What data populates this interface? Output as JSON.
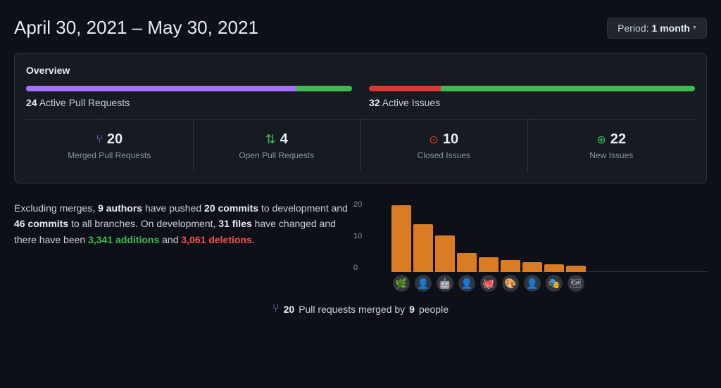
{
  "header": {
    "title": "April 30, 2021 – May 30, 2021",
    "period_label": "Period:",
    "period_value": "1 month"
  },
  "overview": {
    "title": "Overview",
    "pull_requests": {
      "label": "Active Pull Requests",
      "count": "24",
      "bar_purple_pct": 83,
      "bar_green_pct": 17
    },
    "issues": {
      "label": "Active Issues",
      "count": "32",
      "bar_red_pct": 22,
      "bar_green_pct": 78
    },
    "metrics": [
      {
        "icon": "⑂",
        "icon_color": "#a371f7",
        "number": "20",
        "description": "Merged Pull Requests"
      },
      {
        "icon": "⇅",
        "icon_color": "#3fb950",
        "number": "4",
        "description": "Open Pull Requests"
      },
      {
        "icon": "⊙",
        "icon_color": "#da3633",
        "number": "10",
        "description": "Closed Issues"
      },
      {
        "icon": "⊕",
        "icon_color": "#3fb950",
        "number": "22",
        "description": "New Issues"
      }
    ]
  },
  "commit_summary": {
    "text1": "Excluding merges,",
    "authors_count": "9 authors",
    "text2": "have pushed",
    "commits_dev": "20 commits",
    "text3": "to development and",
    "commits_all": "46 commits",
    "text4": "to all branches. On development,",
    "files": "31 files",
    "text5": "have changed and there have been",
    "additions": "3,341 additions",
    "text6": "and",
    "deletions": "3,061 deletions",
    "text7": "."
  },
  "chart": {
    "y_labels": [
      "20",
      "10",
      "0"
    ],
    "bars": [
      {
        "height_pct": 100,
        "avatar": "🌿"
      },
      {
        "height_pct": 72,
        "avatar": "👤"
      },
      {
        "height_pct": 55,
        "avatar": "🤖"
      },
      {
        "height_pct": 28,
        "avatar": "👤"
      },
      {
        "height_pct": 22,
        "avatar": "🐙"
      },
      {
        "height_pct": 18,
        "avatar": "🎨"
      },
      {
        "height_pct": 15,
        "avatar": "👤"
      },
      {
        "height_pct": 12,
        "avatar": "🎭"
      },
      {
        "height_pct": 10,
        "avatar": "🗺"
      }
    ]
  },
  "footer": {
    "icon": "⑂",
    "merged_count": "20",
    "text1": "Pull requests merged by",
    "people_count": "9",
    "text2": "people"
  }
}
